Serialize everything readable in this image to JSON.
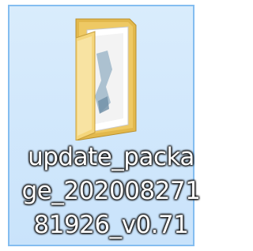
{
  "desktop_item": {
    "icon": "folder-icon",
    "selected": true,
    "name_lines": [
      "update_packa",
      "ge_202008271",
      "81926_v0.71"
    ]
  },
  "colors": {
    "selection_fill": "#cfe6fb",
    "selection_border": "#84bdf0",
    "label_text": "#ffffff",
    "folder_back": "#e8c35a",
    "folder_front": "#f6dd8d"
  }
}
